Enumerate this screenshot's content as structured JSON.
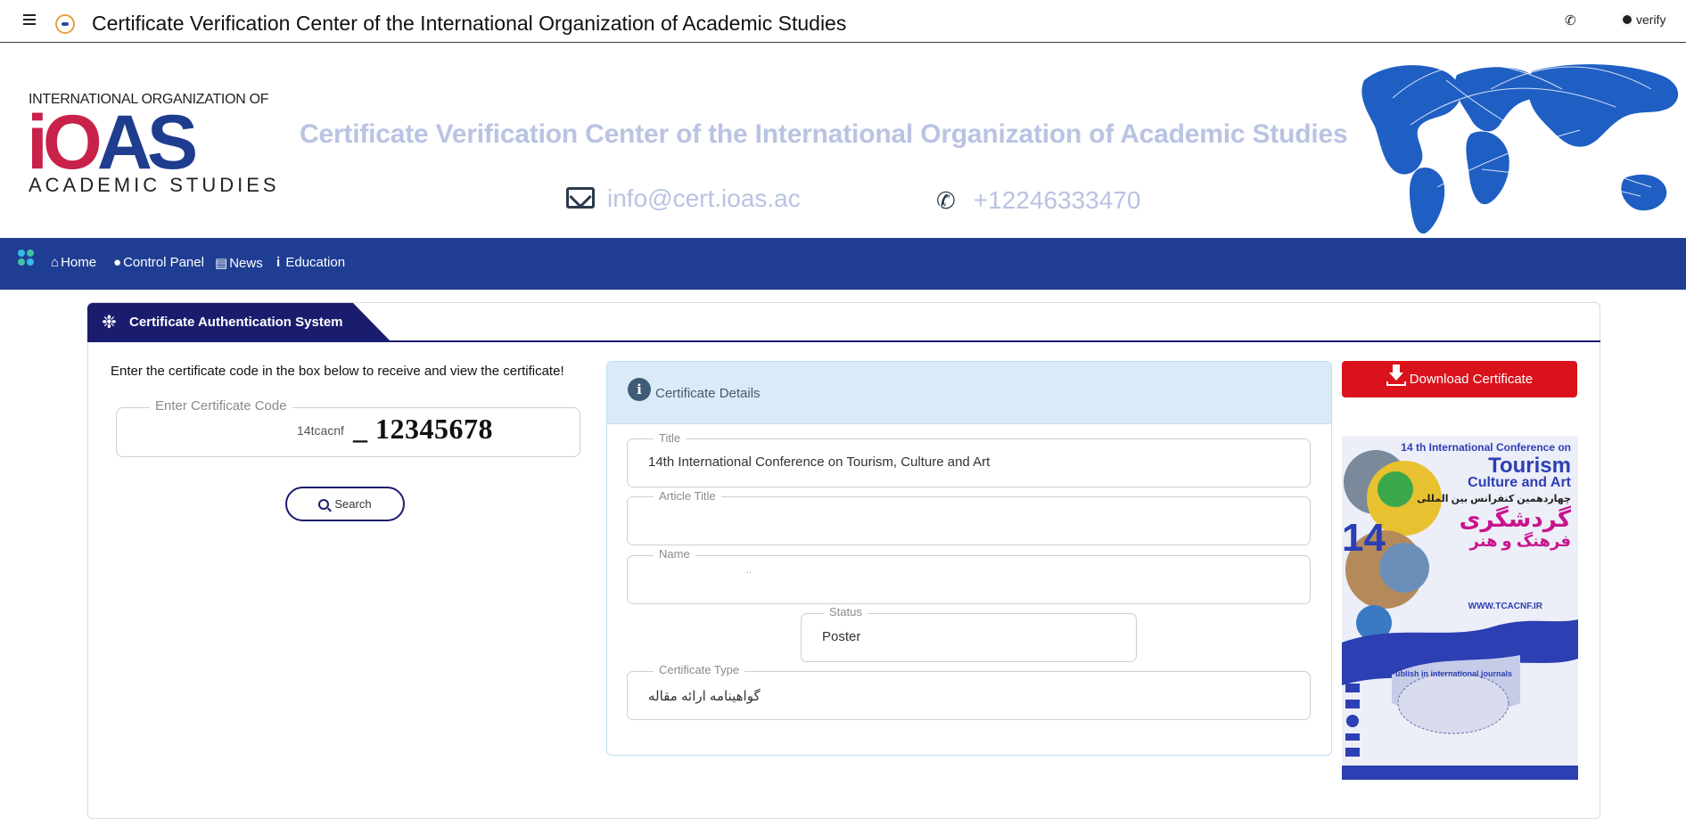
{
  "topbar": {
    "title": "Certificate Verification Center of the International Organization of Academic Studies",
    "verify_label": "verify"
  },
  "banner": {
    "logo_top": "INTERNATIONAL ORGANIZATION OF",
    "logo_main": "iOAS",
    "logo_bottom": "ACADEMIC STUDIES",
    "title": "Certificate Verification Center of the International Organization of Academic Studies",
    "email": "info@cert.ioas.ac",
    "phone": "+12246333470"
  },
  "nav": {
    "items": [
      {
        "label": "Home",
        "icon": "home-icon"
      },
      {
        "label": "Control Panel",
        "icon": "user-icon"
      },
      {
        "label": "News",
        "icon": "newspaper-icon"
      },
      {
        "label": "Education",
        "icon": "info-icon"
      }
    ]
  },
  "card": {
    "tab_title": "Certificate Authentication System",
    "instructions": "Enter the certificate code in the box below to receive and view the certificate!",
    "code_label": "Enter Certificate Code",
    "code_prefix": "14tcacnf",
    "code_value": "_ 12345678",
    "search_label": "Search"
  },
  "details": {
    "title": "Certificate Details",
    "fields": {
      "title": {
        "label": "Title",
        "value": "14th International Conference on Tourism, Culture and Art"
      },
      "article_title": {
        "label": "Article Title",
        "value": ""
      },
      "name": {
        "label": "Name",
        "value": ".."
      },
      "status": {
        "label": "Status",
        "value": "Poster"
      },
      "certificate_type": {
        "label": "Certificate Type",
        "value": "گواهینامه ارائه مقاله"
      }
    }
  },
  "download": {
    "label": "Download Certificate"
  },
  "poster": {
    "line1": "14 th International Conference on",
    "line2": "Tourism",
    "line3": "Culture and Art",
    "line4": "چهاردهمین کنفرانس بین المللی",
    "line5": "گردشگری",
    "line6": "فرهنگ و هنر",
    "number": "14",
    "website": "WWW.TCACNF.IR",
    "journals": "Publish in international journals"
  },
  "colors": {
    "nav_blue": "#1f3e93",
    "tab_navy": "#1a1c6e",
    "download_red": "#d9121b",
    "banner_text": "#b9c3e2",
    "logo_red": "#c8214a",
    "logo_blue": "#1f3d8f"
  }
}
